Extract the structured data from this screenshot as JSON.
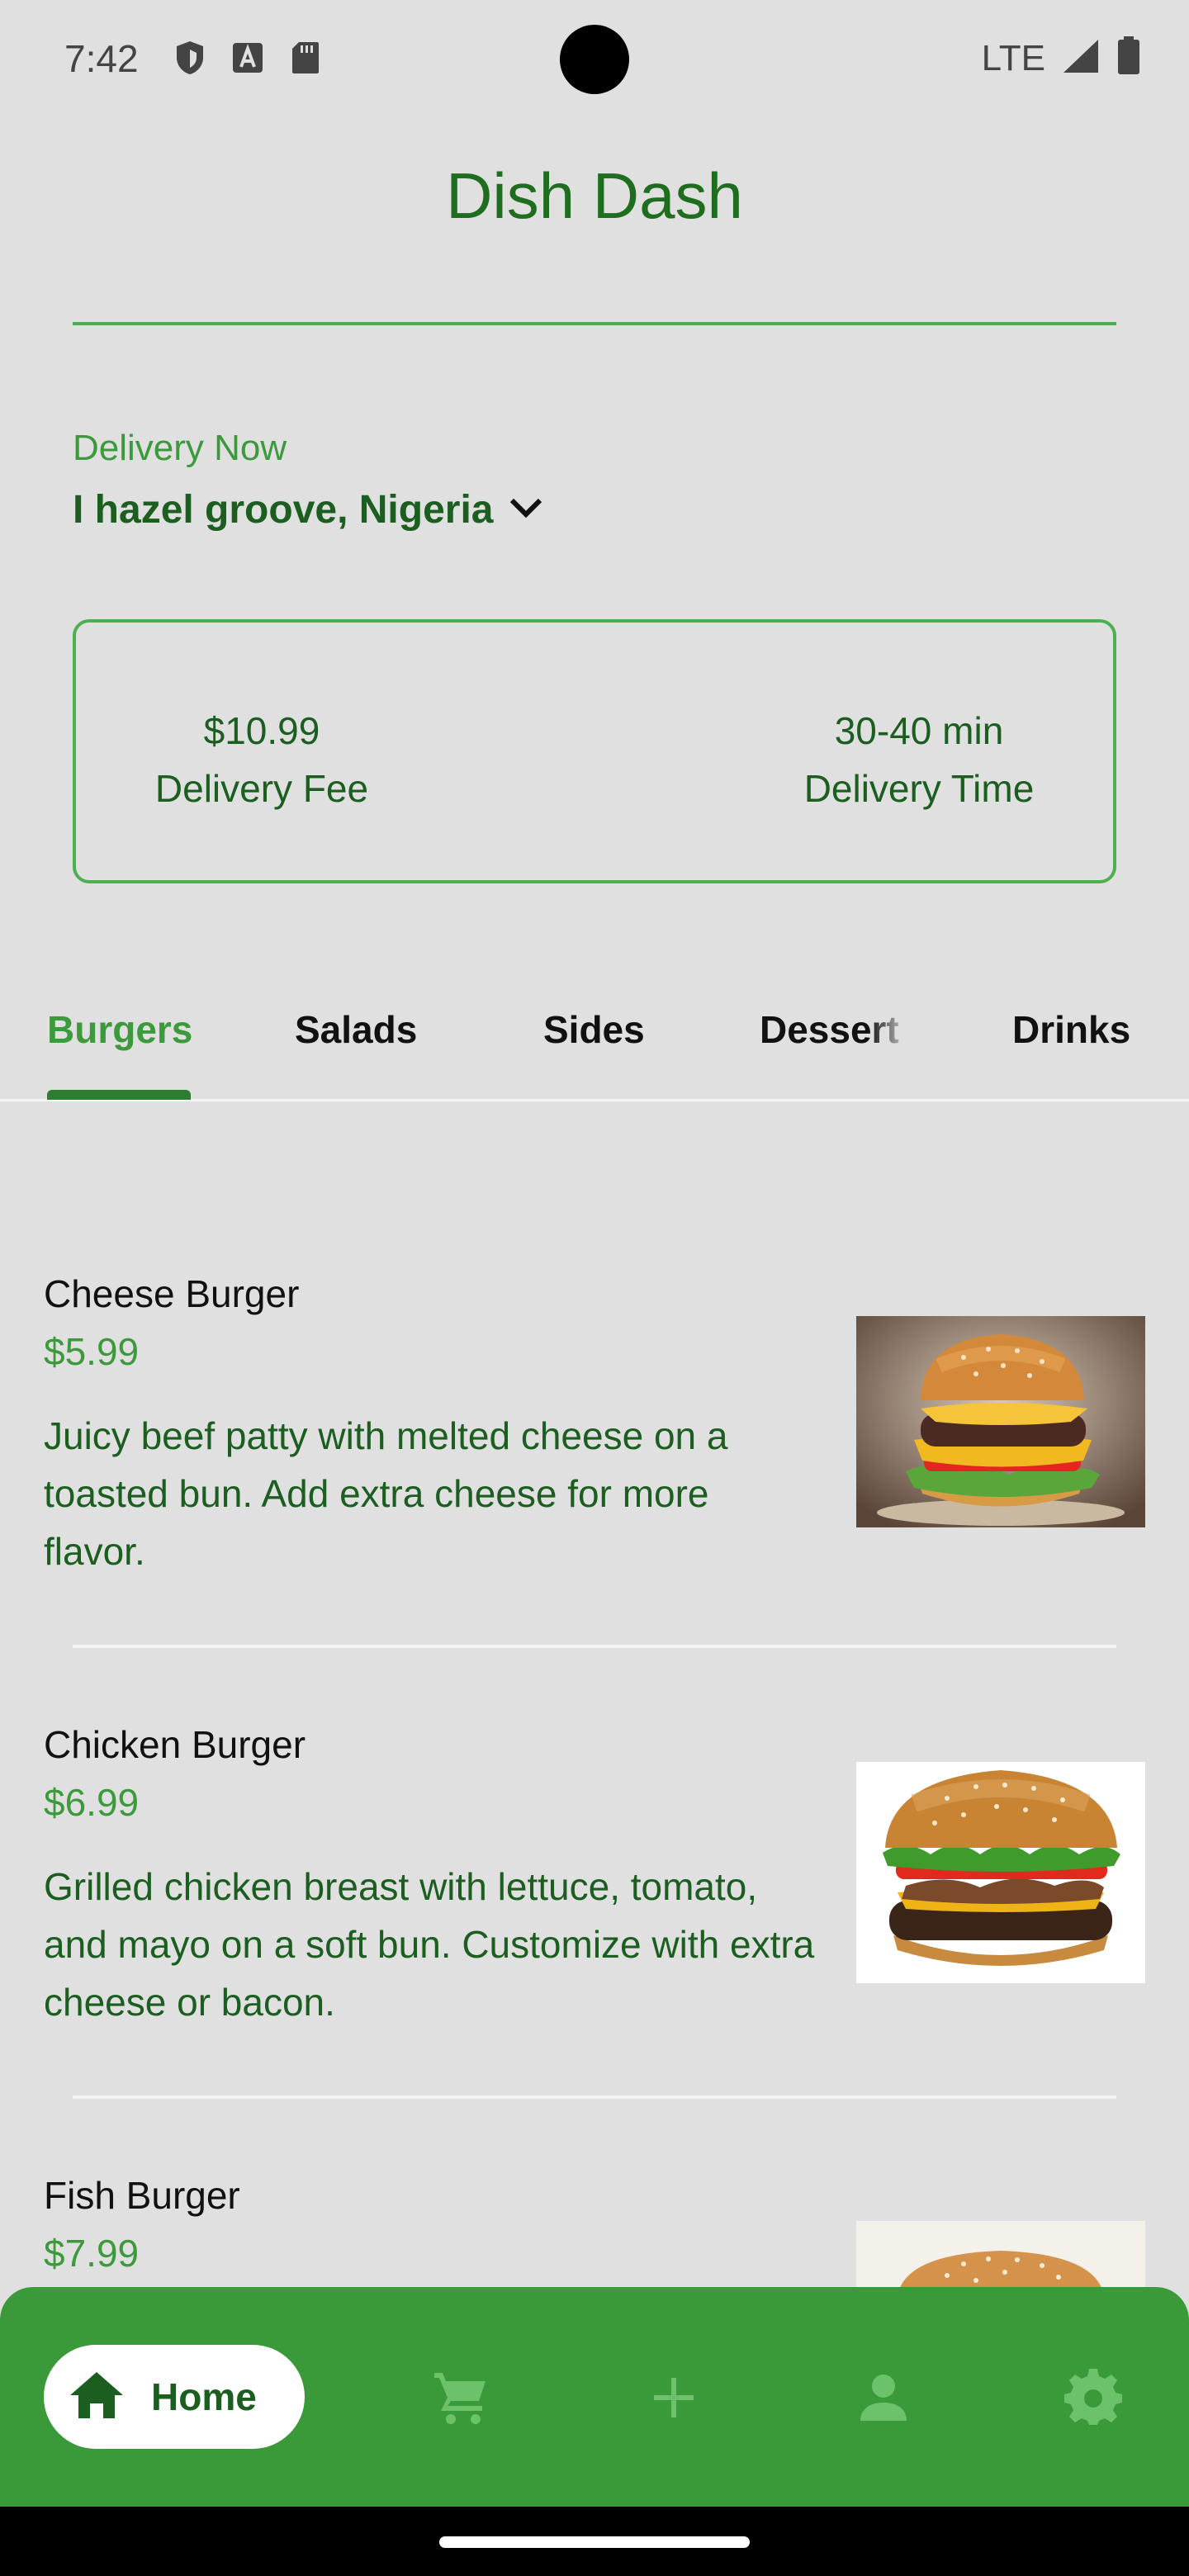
{
  "status_bar": {
    "time": "7:42",
    "network": "LTE"
  },
  "app": {
    "title": "Dish Dash"
  },
  "delivery": {
    "label": "Delivery Now",
    "location": "I hazel groove, Nigeria"
  },
  "info_card": {
    "fee_value": "$10.99",
    "fee_label": "Delivery Fee",
    "time_value": "30-40 min",
    "time_label": "Delivery Time"
  },
  "tabs": [
    {
      "label": "Burgers",
      "active": true
    },
    {
      "label": "Salads",
      "active": false
    },
    {
      "label": "Sides",
      "active": false
    },
    {
      "label": "Dessert",
      "active": false
    },
    {
      "label": "Drinks",
      "active": false
    }
  ],
  "menu_items": [
    {
      "name": "Cheese Burger",
      "price": "$5.99",
      "description": "Juicy beef patty with melted cheese on a toasted bun. Add extra cheese for more flavor."
    },
    {
      "name": "Chicken Burger",
      "price": "$6.99",
      "description": "Grilled chicken breast with lettuce, tomato, and mayo on a soft bun. Customize with extra cheese or bacon."
    },
    {
      "name": "Fish Burger",
      "price": "$7.99",
      "description": ""
    }
  ],
  "bottom_nav": {
    "home_label": "Home",
    "icons": [
      "home-icon",
      "cart-icon",
      "add-icon",
      "person-icon",
      "settings-icon"
    ]
  },
  "colors": {
    "primary": "#3a9a3a",
    "dark_green": "#1b5e20",
    "background": "#e0e0e0"
  }
}
